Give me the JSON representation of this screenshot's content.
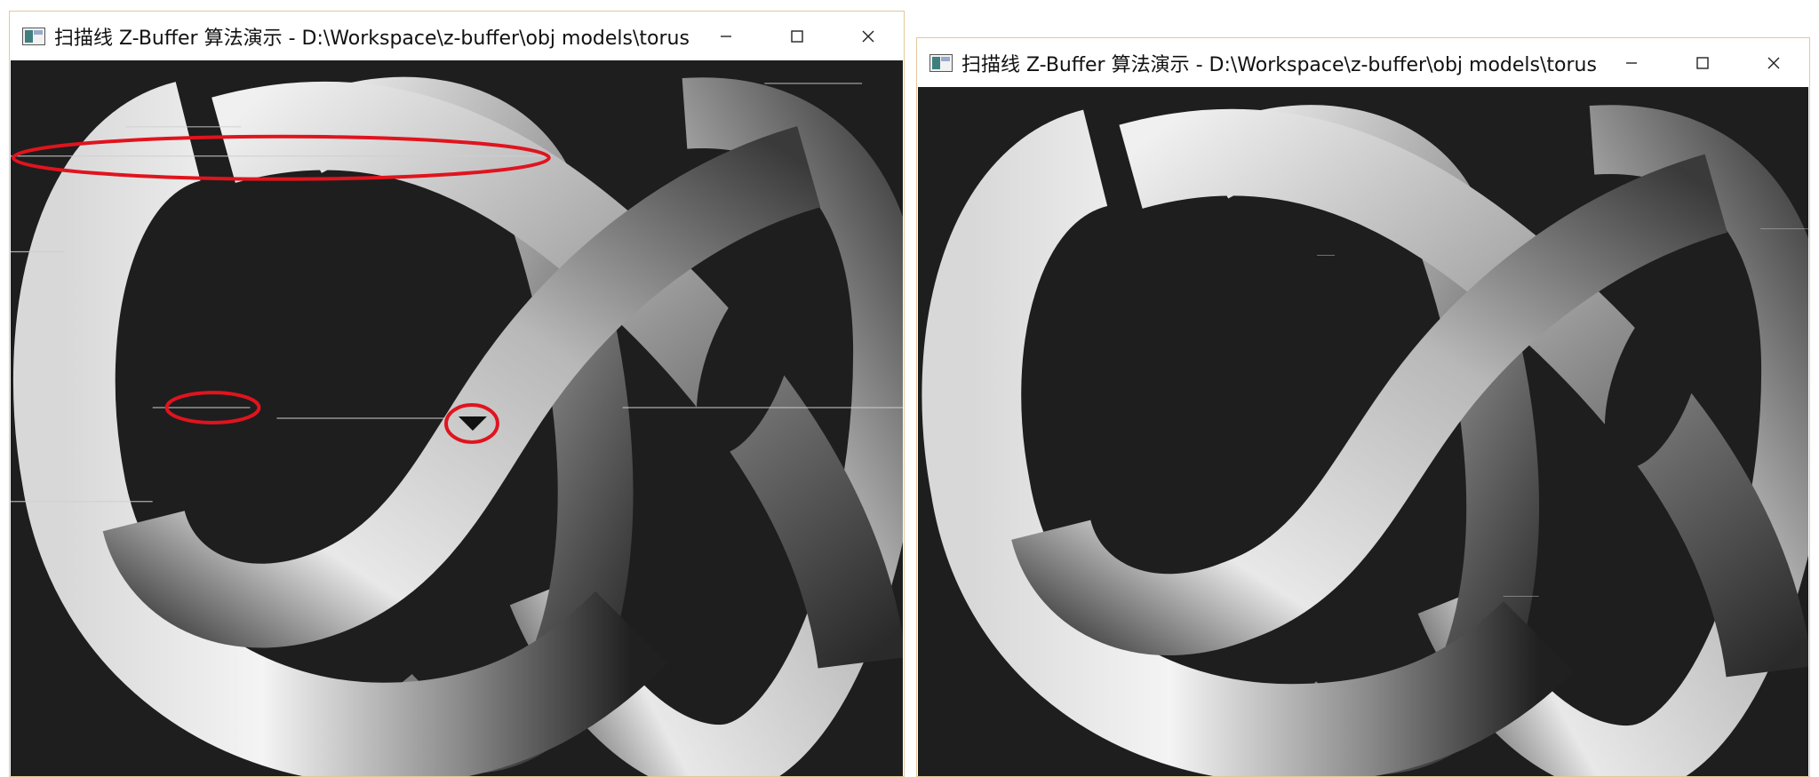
{
  "windows": {
    "left": {
      "title": "扫描线 Z-Buffer 算法演示 - D:\\Workspace\\z-buffer\\obj models\\torusk...",
      "app_icon": "app-window-icon",
      "controls": {
        "minimize": "minimize-icon",
        "maximize": "maximize-icon",
        "close": "close-icon"
      }
    },
    "right": {
      "title": "扫描线 Z-Buffer 算法演示 - D:\\Workspace\\z-buffer\\obj models\\torusk...",
      "app_icon": "app-window-icon",
      "controls": {
        "minimize": "minimize-icon",
        "maximize": "maximize-icon",
        "close": "close-icon"
      }
    }
  },
  "colors": {
    "canvas_background": "#1e1e1e",
    "window_border": "#e4c89a",
    "annotation_red": "#e0141e"
  }
}
